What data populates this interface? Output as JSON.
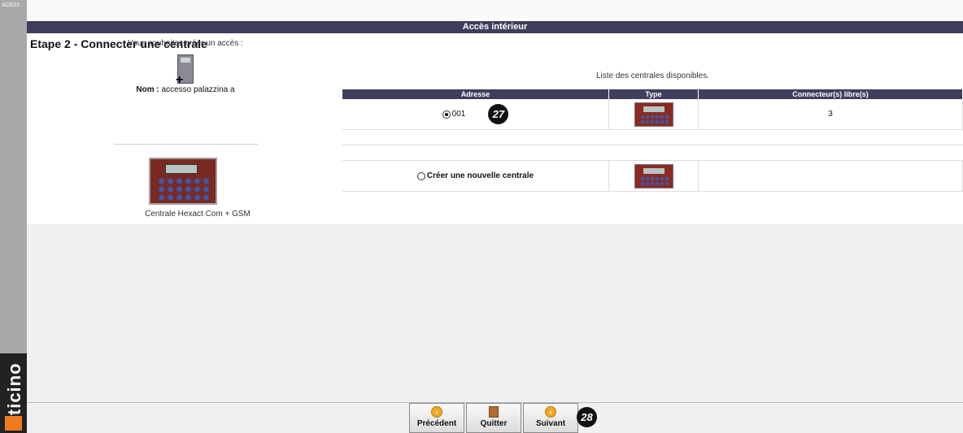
{
  "window": {
    "code": "ACE01",
    "brand": "bticino"
  },
  "header": {
    "title": "Accès intérieur"
  },
  "step": {
    "title": "Etape 2 - Connecter une centrale"
  },
  "left_panel": {
    "question": "Vous souhaitez créer un accès :",
    "name_label": "Nom :",
    "name_value": "accesso palazzina a",
    "device_name": "Centrale Hexact Com + GSM"
  },
  "list": {
    "title": "Liste des centrales disponibles.",
    "columns": [
      "Adresse",
      "Type",
      "Connecteur(s) libre(s)"
    ],
    "rows": [
      {
        "address": "001",
        "free_connectors": "3",
        "selected": true
      }
    ],
    "new_option": "Créer une nouvelle centrale"
  },
  "annotations": {
    "marker1": "27",
    "marker2": "28"
  },
  "buttons": {
    "previous": "Précédent",
    "quit": "Quitter",
    "next": "Suivant"
  }
}
